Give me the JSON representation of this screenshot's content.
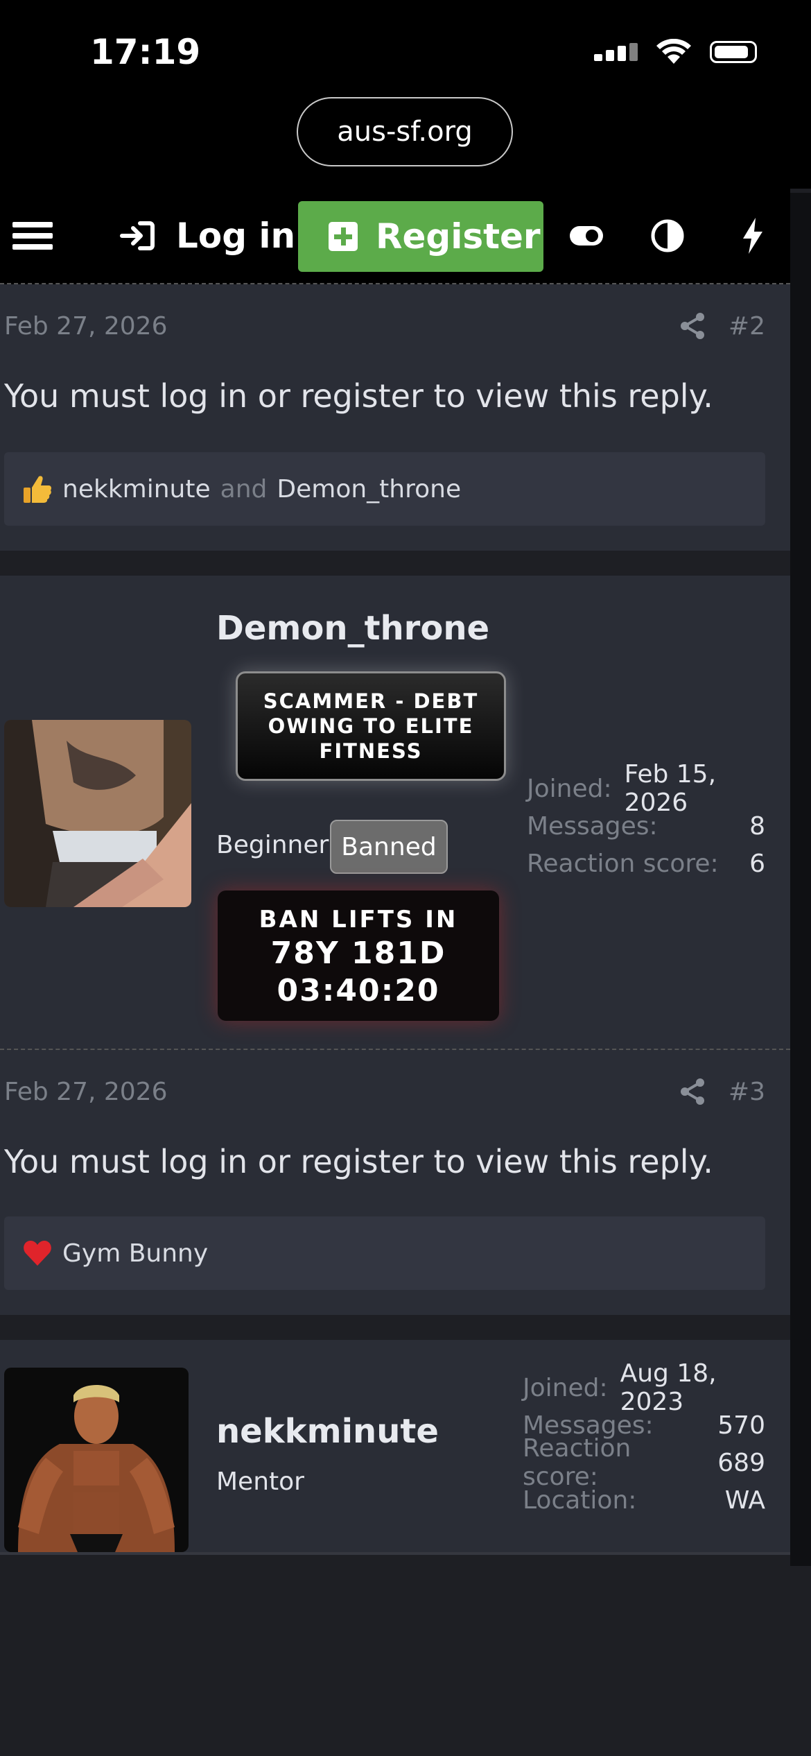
{
  "status_bar": {
    "time": "17:19"
  },
  "browser": {
    "url": "aus-sf.org"
  },
  "nav": {
    "login_label": "Log in",
    "register_label": "Register"
  },
  "posts": [
    {
      "date": "Feb 27, 2026",
      "number": "#2",
      "message": "You must log in or register to view this reply.",
      "reaction_icon": "thumbs-up",
      "reaction_user1": "nekkminute",
      "reaction_and": "and",
      "reaction_user2": "Demon_throne"
    },
    {
      "date": "Feb 27, 2026",
      "number": "#3",
      "message": "You must log in or register to view this reply.",
      "reaction_icon": "heart",
      "reaction_user1": "Gym Bunny"
    }
  ],
  "users": [
    {
      "name": "Demon_throne",
      "banner": "SCAMMER - DEBT OWING TO ELITE FITNESS",
      "rank": "Beginner",
      "badge": "Banned",
      "ban_line1": "BAN LIFTS IN",
      "ban_line2": "78Y 181D",
      "ban_line3": "03:40:20",
      "stats": [
        {
          "key": "Joined:",
          "value": "Feb 15, 2026"
        },
        {
          "key": "Messages:",
          "value": "8"
        },
        {
          "key": "Reaction score:",
          "value": "6"
        }
      ]
    },
    {
      "name": "nekkminute",
      "rank": "Mentor",
      "stats": [
        {
          "key": "Joined:",
          "value": "Aug 18, 2023"
        },
        {
          "key": "Messages:",
          "value": "570"
        },
        {
          "key": "Reaction score:",
          "value": "689"
        },
        {
          "key": "Location:",
          "value": "WA"
        }
      ]
    }
  ],
  "colors": {
    "register": "#5cab4a",
    "panel": "#2a2d36",
    "page": "#1e1f24"
  }
}
